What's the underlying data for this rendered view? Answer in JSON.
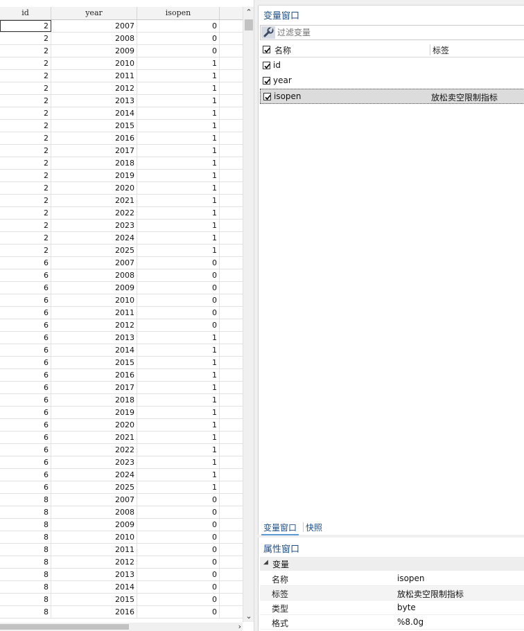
{
  "grid": {
    "columns": [
      "id",
      "year",
      "isopen"
    ],
    "rows": [
      [
        "2",
        "2007",
        "0"
      ],
      [
        "2",
        "2008",
        "0"
      ],
      [
        "2",
        "2009",
        "0"
      ],
      [
        "2",
        "2010",
        "1"
      ],
      [
        "2",
        "2011",
        "1"
      ],
      [
        "2",
        "2012",
        "1"
      ],
      [
        "2",
        "2013",
        "1"
      ],
      [
        "2",
        "2014",
        "1"
      ],
      [
        "2",
        "2015",
        "1"
      ],
      [
        "2",
        "2016",
        "1"
      ],
      [
        "2",
        "2017",
        "1"
      ],
      [
        "2",
        "2018",
        "1"
      ],
      [
        "2",
        "2019",
        "1"
      ],
      [
        "2",
        "2020",
        "1"
      ],
      [
        "2",
        "2021",
        "1"
      ],
      [
        "2",
        "2022",
        "1"
      ],
      [
        "2",
        "2023",
        "1"
      ],
      [
        "2",
        "2024",
        "1"
      ],
      [
        "2",
        "2025",
        "1"
      ],
      [
        "6",
        "2007",
        "0"
      ],
      [
        "6",
        "2008",
        "0"
      ],
      [
        "6",
        "2009",
        "0"
      ],
      [
        "6",
        "2010",
        "0"
      ],
      [
        "6",
        "2011",
        "0"
      ],
      [
        "6",
        "2012",
        "0"
      ],
      [
        "6",
        "2013",
        "1"
      ],
      [
        "6",
        "2014",
        "1"
      ],
      [
        "6",
        "2015",
        "1"
      ],
      [
        "6",
        "2016",
        "1"
      ],
      [
        "6",
        "2017",
        "1"
      ],
      [
        "6",
        "2018",
        "1"
      ],
      [
        "6",
        "2019",
        "1"
      ],
      [
        "6",
        "2020",
        "1"
      ],
      [
        "6",
        "2021",
        "1"
      ],
      [
        "6",
        "2022",
        "1"
      ],
      [
        "6",
        "2023",
        "1"
      ],
      [
        "6",
        "2024",
        "1"
      ],
      [
        "6",
        "2025",
        "1"
      ],
      [
        "8",
        "2007",
        "0"
      ],
      [
        "8",
        "2008",
        "0"
      ],
      [
        "8",
        "2009",
        "0"
      ],
      [
        "8",
        "2010",
        "0"
      ],
      [
        "8",
        "2011",
        "0"
      ],
      [
        "8",
        "2012",
        "0"
      ],
      [
        "8",
        "2013",
        "0"
      ],
      [
        "8",
        "2014",
        "0"
      ],
      [
        "8",
        "2015",
        "0"
      ],
      [
        "8",
        "2016",
        "0"
      ]
    ]
  },
  "variables_window": {
    "title": "变量窗口",
    "filter_placeholder": "过滤变量",
    "header_name": "名称",
    "header_label": "标签",
    "variables": [
      {
        "name": "id",
        "label": ""
      },
      {
        "name": "year",
        "label": ""
      },
      {
        "name": "isopen",
        "label": "放松卖空限制指标"
      }
    ]
  },
  "tabs": [
    "变量窗口",
    "快照"
  ],
  "properties_window": {
    "title": "属性窗口",
    "section": "变量",
    "rows": [
      {
        "key": "名称",
        "value": "isopen"
      },
      {
        "key": "标签",
        "value": "放松卖空限制指标"
      },
      {
        "key": "类型",
        "value": "byte"
      },
      {
        "key": "格式",
        "value": "%8.0g"
      }
    ]
  },
  "colors": {
    "accent": "#1d4e89",
    "selected_row": "#dcdcdc",
    "tab_underline": "#5b9bd5"
  }
}
